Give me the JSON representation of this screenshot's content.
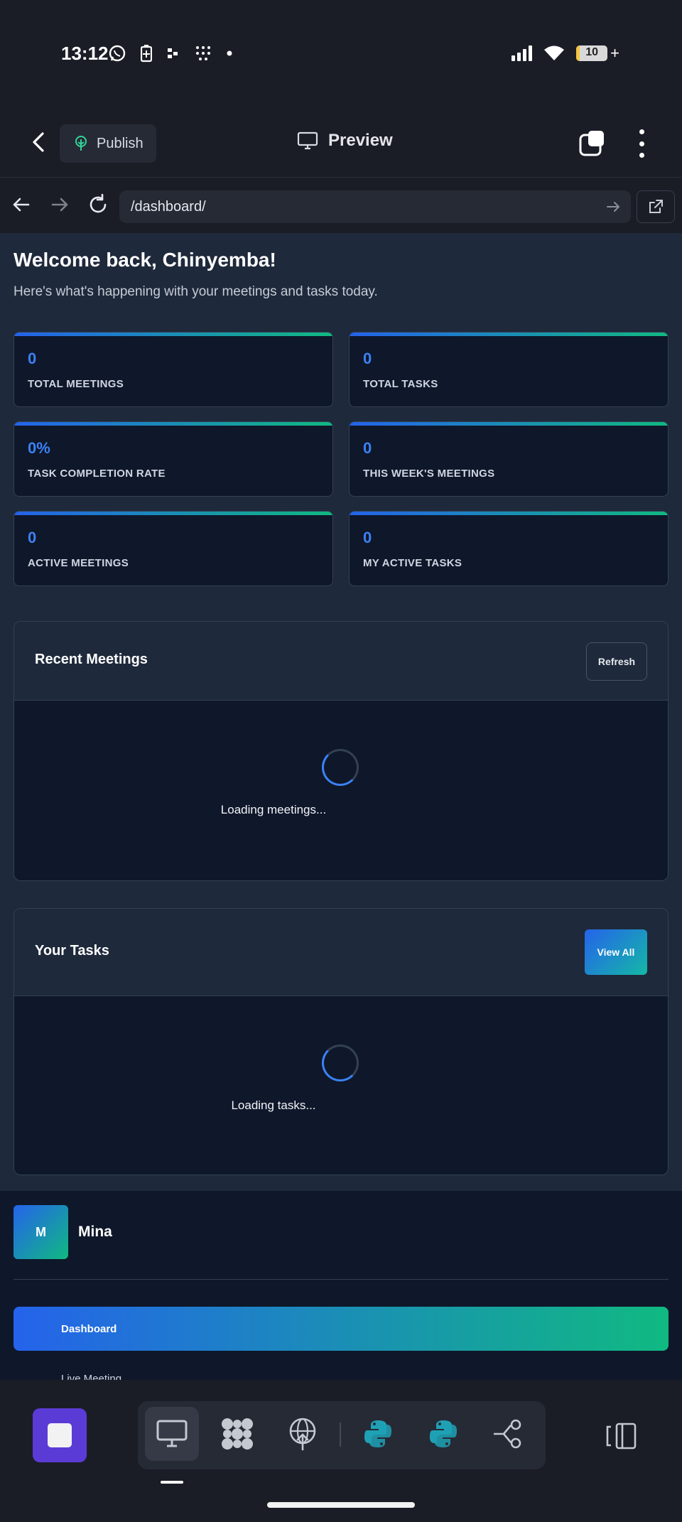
{
  "status_bar": {
    "time": "13:12",
    "left_icons": [
      "whatsapp-icon",
      "battery-saver-icon",
      "app-icon",
      "dots-grid-icon",
      "dot-icon"
    ],
    "right_icons": [
      "signal-icon",
      "wifi-icon"
    ],
    "battery_level": "10",
    "battery_suffix": "+"
  },
  "app_header": {
    "back_icon": "chevron-left-icon",
    "publish_label": "Publish",
    "preview_label": "Preview"
  },
  "browser": {
    "url": "/dashboard/"
  },
  "dashboard": {
    "welcome": "Welcome back, Chinyemba!",
    "subtitle": "Here's what's happening with your meetings and tasks today.",
    "stats": [
      {
        "value": "0",
        "label": "TOTAL MEETINGS"
      },
      {
        "value": "0",
        "label": "TOTAL TASKS"
      },
      {
        "value": "0%",
        "label": "TASK COMPLETION RATE"
      },
      {
        "value": "0",
        "label": "THIS WEEK'S MEETINGS"
      },
      {
        "value": "0",
        "label": "ACTIVE MEETINGS"
      },
      {
        "value": "0",
        "label": "MY ACTIVE TASKS"
      }
    ],
    "recent_meetings": {
      "title": "Recent Meetings",
      "refresh_label": "Refresh",
      "loading_text": "Loading meetings..."
    },
    "your_tasks": {
      "title": "Your Tasks",
      "view_all_label": "View All",
      "loading_text": "Loading tasks..."
    }
  },
  "sidebar": {
    "avatar_initial": "M",
    "username": "Mina",
    "nav_items": [
      "Dashboard",
      "Live Meeting"
    ],
    "active_item": "Dashboard"
  },
  "colors": {
    "accent_blue": "#2563eb",
    "accent_green": "#10b981",
    "stat_value": "#3b82f6",
    "stop_button": "#5b3bd6"
  }
}
